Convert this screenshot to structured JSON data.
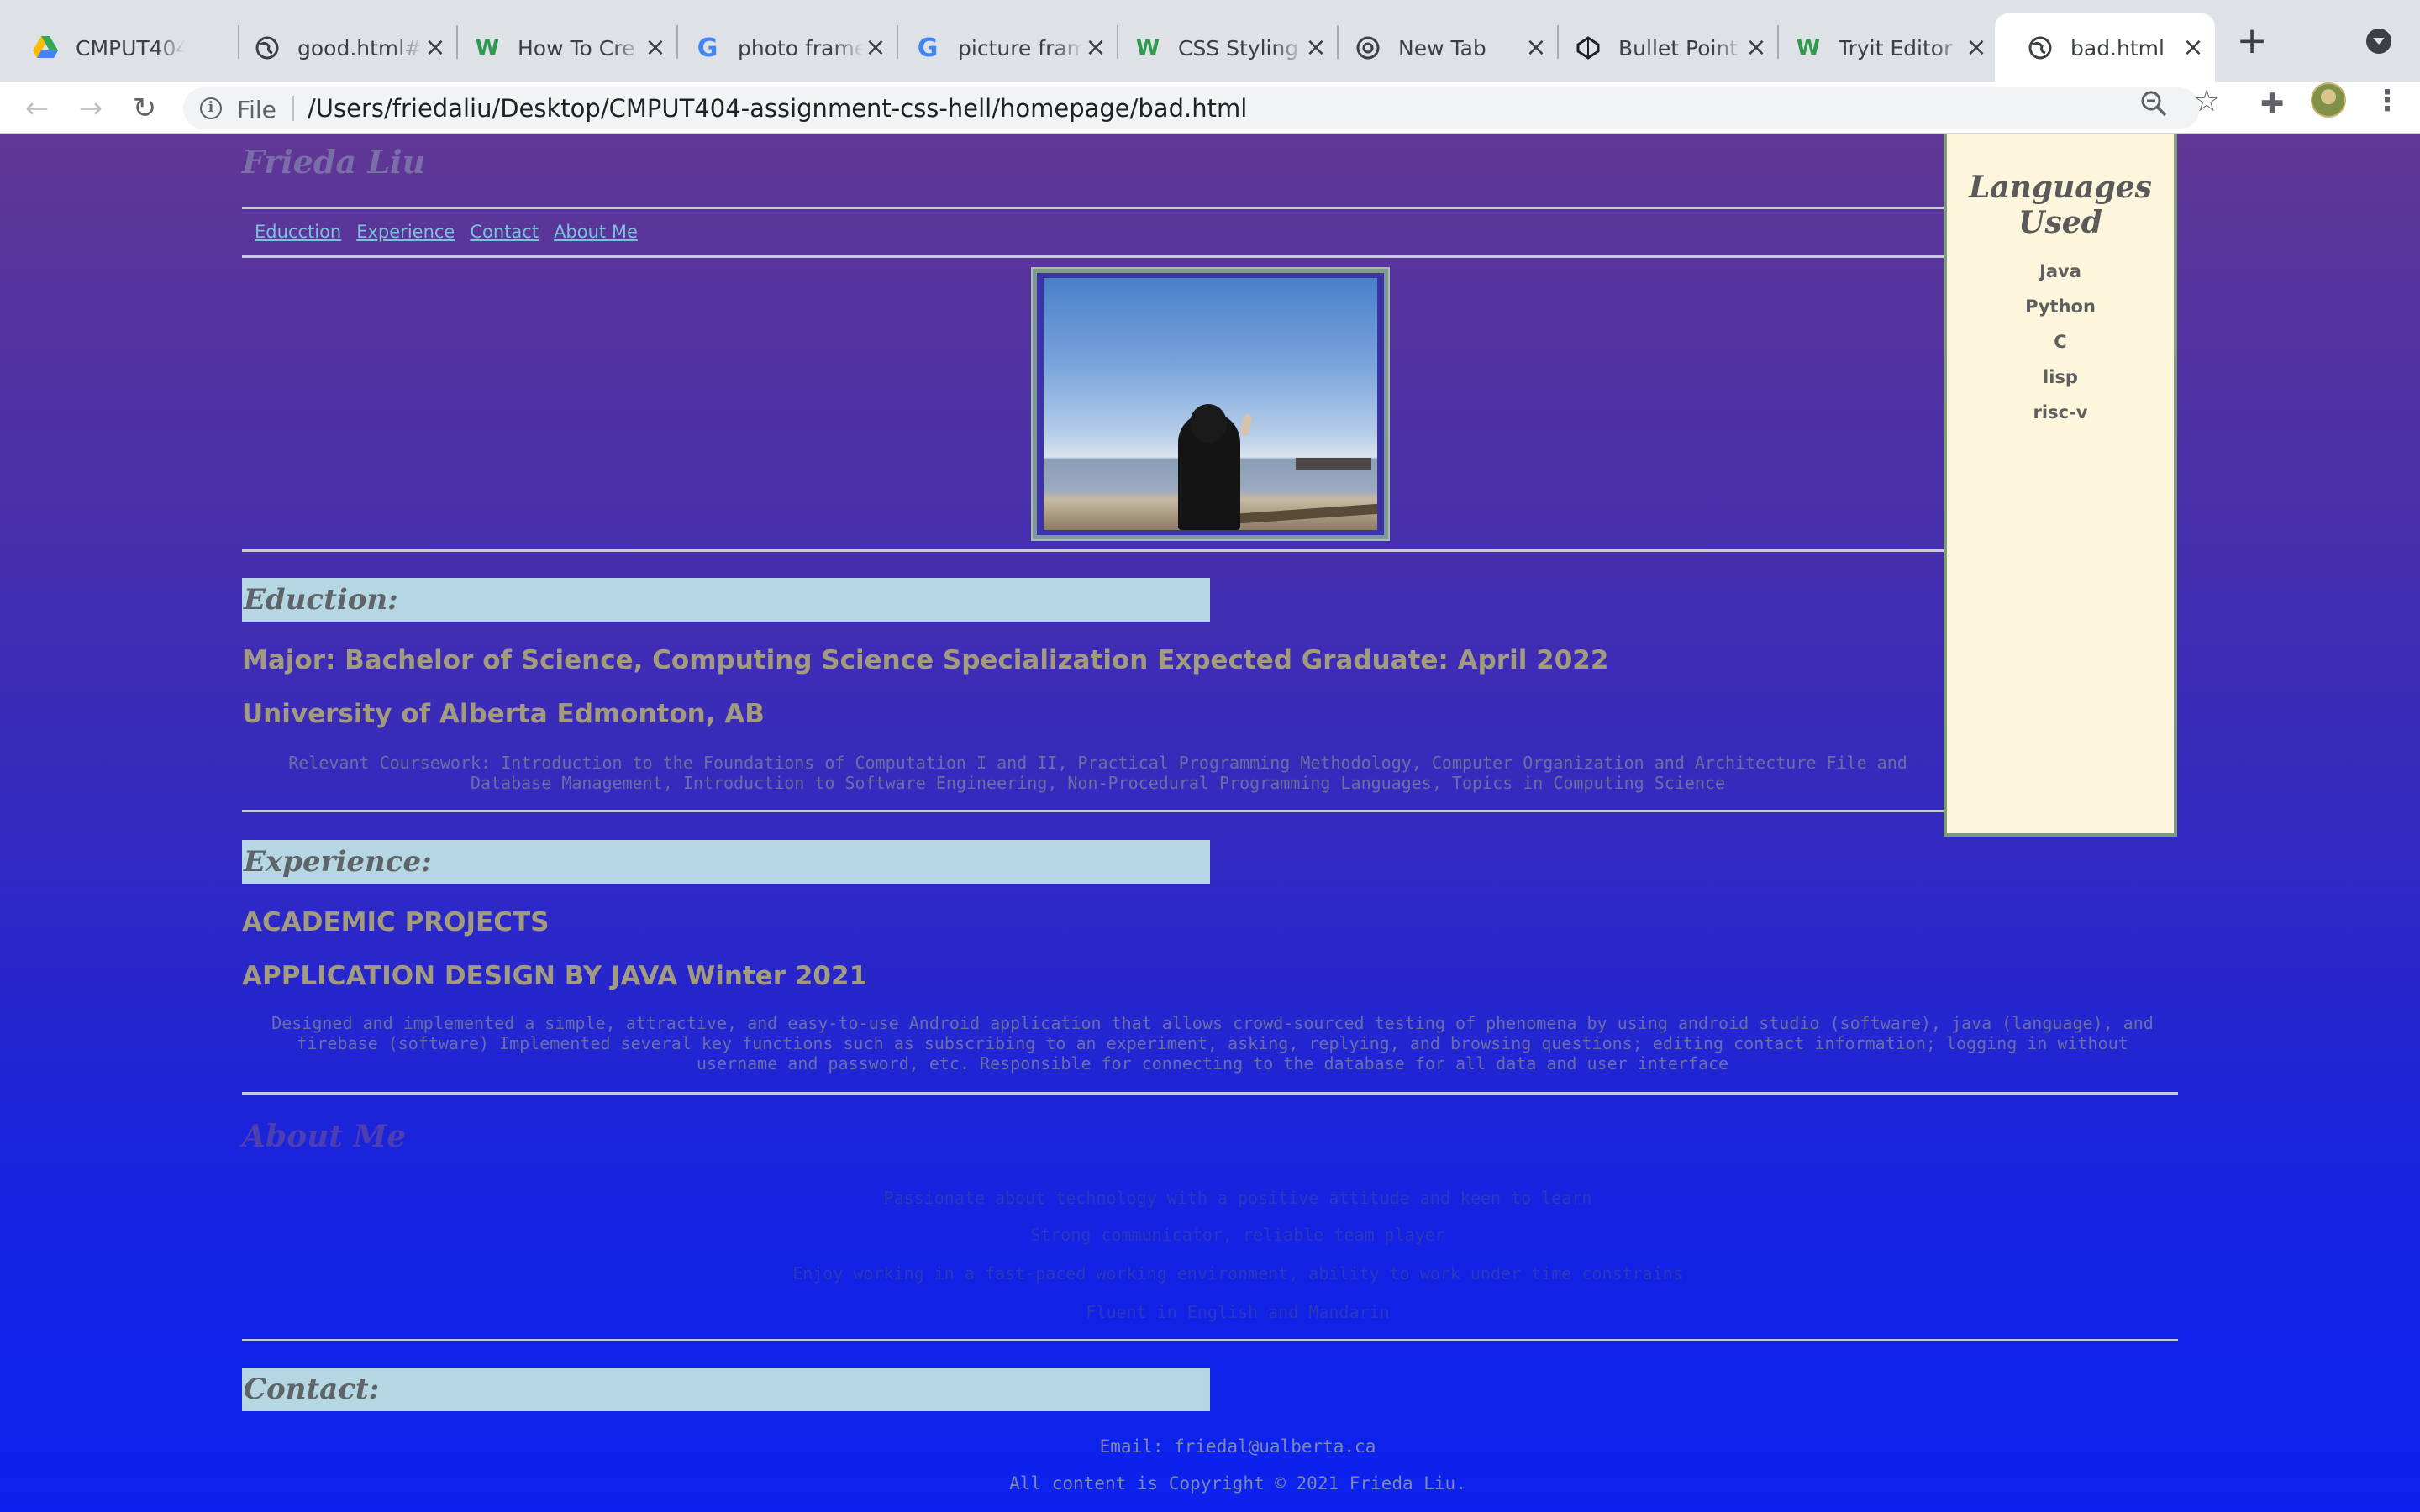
{
  "browser": {
    "tabs": [
      {
        "title": "CMPUT404",
        "favicon": "google-drive-icon"
      },
      {
        "title": "good.html#",
        "favicon": "globe-icon"
      },
      {
        "title": "How To Cre",
        "favicon": "w3schools-icon"
      },
      {
        "title": "photo frame",
        "favicon": "google-icon"
      },
      {
        "title": "picture fram",
        "favicon": "google-icon"
      },
      {
        "title": "CSS Styling",
        "favicon": "w3schools-icon"
      },
      {
        "title": "New Tab",
        "favicon": "chrome-icon"
      },
      {
        "title": "Bullet Point",
        "favicon": "codepen-icon"
      },
      {
        "title": "Tryit Editor",
        "favicon": "w3schools-icon"
      },
      {
        "title": "bad.html",
        "favicon": "globe-icon",
        "active": true
      }
    ],
    "new_tab_label": "+",
    "address_scheme": "File",
    "address_url": "/Users/friedaliu/Desktop/CMPUT404-assignment-css-hell/homepage/bad.html"
  },
  "page": {
    "site_name": "Frieda Liu",
    "nav": [
      "Educction",
      "Experience",
      "Contact",
      "About Me"
    ],
    "sidebar": {
      "title": "Languages Used",
      "items": [
        "Java",
        "Python",
        "C",
        "lisp",
        "risc-v"
      ]
    },
    "education": {
      "heading": "Eduction:",
      "major": "Major: Bachelor of Science, Computing Science Specialization Expected Graduate: April 2022",
      "school": "University of Alberta Edmonton, AB",
      "coursework": "Relevant Coursework: Introduction to the Foundations of Computation I and II, Practical Programming Methodology, Computer Organization and Architecture File and Database Management, Introduction to Software Engineering, Non-Procedural Programming Languages, Topics in Computing Science"
    },
    "experience": {
      "heading": "Experience:",
      "category": "ACADEMIC PROJECTS",
      "project": "APPLICATION DESIGN BY JAVA Winter 2021",
      "description": "Designed and implemented a simple, attractive, and easy-to-use Android application that allows crowd-sourced testing of phenomena by using android studio (software), java (language), and firebase (software) Implemented several key functions such as subscribing to an experiment, asking, replying, and browsing questions; editing contact information; logging in without username and password, etc. Responsible for connecting to the database for all data and user interface"
    },
    "about": {
      "heading": "About Me",
      "lines": [
        "Passionate about technology with a positive attitude and keen to learn",
        "Strong communicator, reliable team player",
        "Enjoy working in a fast-paced working environment, ability to work under time constrains",
        "Fluent in English and Mandarin"
      ]
    },
    "contact": {
      "heading": "Contact:",
      "email": "Email: friedal@ualberta.ca",
      "copyright": "All content is Copyright © 2021 Frieda Liu."
    }
  }
}
